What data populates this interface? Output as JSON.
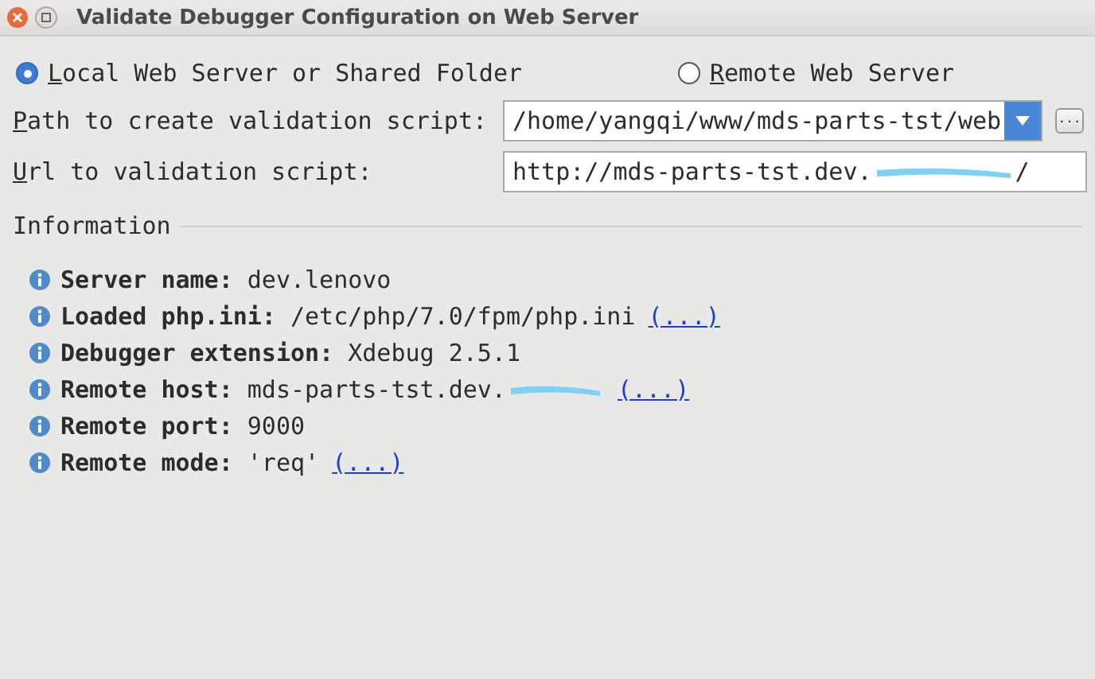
{
  "window": {
    "title": "Validate Debugger Configuration on Web Server"
  },
  "server_type": [
    {
      "label": "Local Web Server or Shared Folder",
      "selected": true
    },
    {
      "label": "Remote Web Server",
      "selected": false
    }
  ],
  "path_field": {
    "label": "Path to create validation script:",
    "value": "/home/yangqi/www/mds-parts-tst/web",
    "browse": "..."
  },
  "url_field": {
    "label": "Url to validation script:",
    "value": "http://mds-parts-tst.dev.",
    "redacted": true,
    "suffix": "/"
  },
  "information": {
    "title": "Information",
    "items": [
      {
        "label": "Server name:",
        "value": "dev.lenovo",
        "redacted": false
      },
      {
        "label": "Loaded php.ini:",
        "value": "/etc/php/7.0/fpm/php.ini",
        "redacted": false,
        "link": "(...)"
      },
      {
        "label": "Debugger extension:",
        "value": "Xdebug 2.5.1",
        "redacted": false
      },
      {
        "label": "Remote host:",
        "value": "mds-parts-tst.dev.",
        "redacted": true,
        "link": "(...)"
      },
      {
        "label": "Remote port:",
        "value": "9000",
        "redacted": false
      },
      {
        "label": "Remote mode:",
        "value": "'req'",
        "redacted": false,
        "link": "(...)"
      }
    ]
  }
}
